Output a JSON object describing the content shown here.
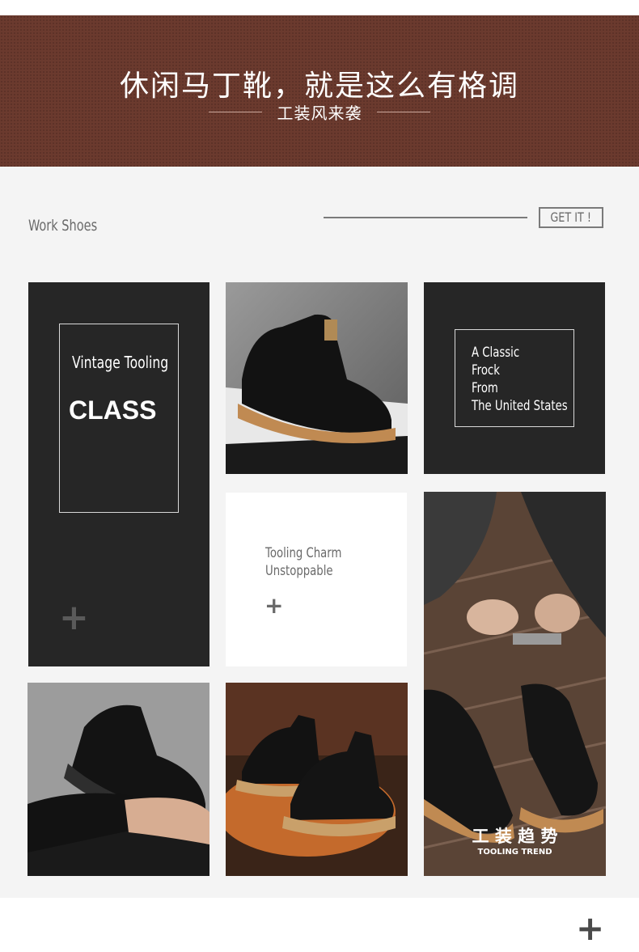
{
  "banner": {
    "title": "休闲马丁靴，就是这么有格调",
    "subtitle": "工装风来袭"
  },
  "header": {
    "section_label": "Work Shoes",
    "cta_label": "GET IT !"
  },
  "tiles": {
    "tile1": {
      "line1": "Vintage Tooling",
      "line2": "CLASS",
      "plus": "+"
    },
    "tile3": {
      "lines": [
        "A Classic",
        "Frock",
        "From",
        "The United States"
      ]
    },
    "tile4": {
      "line1": "Tooling Charm",
      "line2": "Unstoppable",
      "plus": "+"
    },
    "tile5": {
      "cn": "工 装 趋 势",
      "en": "TOOLING TREND"
    }
  },
  "footer": {
    "plus": "+"
  },
  "colors": {
    "banner": "#6b3a2e",
    "dark_tile": "#262626",
    "page_bg": "#f4f4f4"
  }
}
